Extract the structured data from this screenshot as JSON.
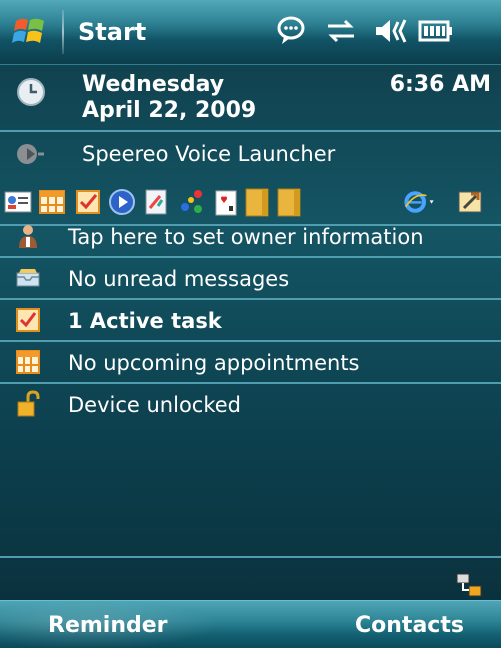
{
  "titlebar": {
    "title": "Start",
    "status_icons": [
      "notification-icon",
      "connectivity-icon",
      "volume-icon",
      "battery-icon"
    ]
  },
  "today": {
    "day": "Wednesday",
    "date": "April 22, 2009",
    "time": "6:36 AM",
    "launcher_label": "Speereo Voice Launcher",
    "app_icons": [
      "contacts-icon",
      "calendar-icon",
      "tasks-icon",
      "media-player-icon",
      "notes-icon",
      "games-icon",
      "solitaire-icon",
      "folder-icon",
      "folder-icon-2",
      "internet-explorer-icon",
      "tools-icon"
    ],
    "items": [
      {
        "icon": "owner-icon",
        "label": "Tap here to set owner information",
        "bold": false
      },
      {
        "icon": "inbox-icon",
        "label": "No unread messages",
        "bold": false
      },
      {
        "icon": "task-icon",
        "label": "1 Active task",
        "bold": true
      },
      {
        "icon": "calendar-icon",
        "label": "No upcoming appointments",
        "bold": false
      },
      {
        "icon": "lock-icon",
        "label": "Device unlocked",
        "bold": false
      }
    ]
  },
  "softkeys": {
    "left": "Reminder",
    "right": "Contacts"
  },
  "colors": {
    "accent": "#2b7f91",
    "divider": "#4f9daf",
    "background": "#145564"
  }
}
